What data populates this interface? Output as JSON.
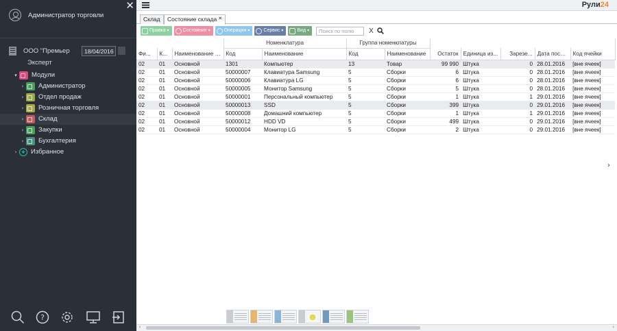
{
  "sidebar": {
    "user_name": "Администратор торговли",
    "company": "ООО \"Премьер",
    "date": "18/04/2016",
    "role": "Эксперт",
    "tree": [
      {
        "label": "Модули",
        "level": 0,
        "color": "#e0457b",
        "expanded": true,
        "selected": false
      },
      {
        "label": "Администратор",
        "level": 1,
        "color": "#4a9d5b",
        "selected": false
      },
      {
        "label": "Отдел продаж",
        "level": 1,
        "color": "#9aa84a",
        "selected": false
      },
      {
        "label": "Розничная торговля",
        "level": 1,
        "color": "#a8a84a",
        "selected": false
      },
      {
        "label": "Склад",
        "level": 1,
        "color": "#c45a5a",
        "selected": true
      },
      {
        "label": "Закупки",
        "level": 1,
        "color": "#4a9d5b",
        "selected": false
      },
      {
        "label": "Бухгалтерия",
        "level": 1,
        "color": "#4a8f7d",
        "selected": false
      },
      {
        "label": "Избранное",
        "level": 0,
        "color": "#2fb6a8",
        "star": true,
        "selected": false
      }
    ],
    "bottom_icons": [
      "search-icon",
      "help-icon",
      "gear-icon",
      "monitor-icon",
      "logout-icon"
    ]
  },
  "topbar": {
    "brand_main": "Рули",
    "brand_accent": "24",
    "accent_color": "#e8893a"
  },
  "tabs": [
    {
      "label": "Склад",
      "active": false,
      "closable": false
    },
    {
      "label": "Состояние склада",
      "active": true,
      "closable": true
    }
  ],
  "toolbar": {
    "buttons": [
      {
        "label": "Правка",
        "color": "#8fd0a0",
        "icon": "edit-icon"
      },
      {
        "label": "Состояние",
        "color": "#f08fa3",
        "icon": "state-icon"
      },
      {
        "label": "Операции",
        "color": "#8ec6ee",
        "icon": "refresh-icon"
      },
      {
        "label": "Сервис",
        "color": "#6a7fa8",
        "icon": "service-icon"
      },
      {
        "label": "Вид",
        "color": "#7aa880",
        "icon": "view-icon"
      }
    ],
    "search_placeholder": "Поиск по полю",
    "clear_label": "X"
  },
  "grid": {
    "group_headers": {
      "nomenclature": "Номенклатура",
      "group": "Группа номенклатуры"
    },
    "columns": [
      "Фи...",
      "К...",
      "Наименование с...",
      "Код",
      "Наименование",
      "Код",
      "Наименование",
      "Остаток",
      "Единица из...",
      "Зарезе...",
      "Дата посл...",
      "Код ячейки"
    ],
    "rows": [
      {
        "cells": [
          "02",
          "01",
          "Основной",
          "1301",
          "Компьютер",
          "13",
          "Товар",
          "99 990",
          "Штука",
          "0",
          "28.01.2016",
          "[вне ячеек]"
        ],
        "highlight": true
      },
      {
        "cells": [
          "02",
          "01",
          "Основной",
          "50000007",
          "Клавиатура Samsung",
          "5",
          "Сборки",
          "6",
          "Штука",
          "0",
          "28.01.2016",
          "[вне ячеек]"
        ],
        "highlight": false
      },
      {
        "cells": [
          "02",
          "01",
          "Основной",
          "50000006",
          "Клавиатура LG",
          "5",
          "Сборки",
          "6",
          "Штука",
          "0",
          "28.01.2016",
          "[вне ячеек]"
        ],
        "highlight": false
      },
      {
        "cells": [
          "02",
          "01",
          "Основной",
          "50000005",
          "Монитор Samsung",
          "5",
          "Сборки",
          "5",
          "Штука",
          "0",
          "28.01.2016",
          "[вне ячеек]"
        ],
        "highlight": false
      },
      {
        "cells": [
          "02",
          "01",
          "Основной",
          "50000001",
          "Персональный компьютер",
          "5",
          "Сборки",
          "1",
          "Штука",
          "1",
          "29.01.2016",
          "[вне ячеек]"
        ],
        "highlight": false
      },
      {
        "cells": [
          "02",
          "01",
          "Основной",
          "50000013",
          "SSD",
          "5",
          "Сборки",
          "399",
          "Штука",
          "0",
          "29.01.2016",
          "[вне ячеек]"
        ],
        "highlight": true
      },
      {
        "cells": [
          "02",
          "01",
          "Основной",
          "50000008",
          "Домашний компьютер",
          "5",
          "Сборки",
          "1",
          "Штука",
          "1",
          "29.01.2016",
          "[вне ячеек]"
        ],
        "highlight": false
      },
      {
        "cells": [
          "02",
          "01",
          "Основной",
          "50000012",
          "HDD VD",
          "5",
          "Сборки",
          "499",
          "Штука",
          "0",
          "29.01.2016",
          "[вне ячеек]"
        ],
        "highlight": false
      },
      {
        "cells": [
          "02",
          "01",
          "Основной",
          "50000004",
          "Монитор LG",
          "5",
          "Сборки",
          "2",
          "Штука",
          "0",
          "29.01.2016",
          "[вне ячеек]"
        ],
        "highlight": false
      }
    ]
  }
}
